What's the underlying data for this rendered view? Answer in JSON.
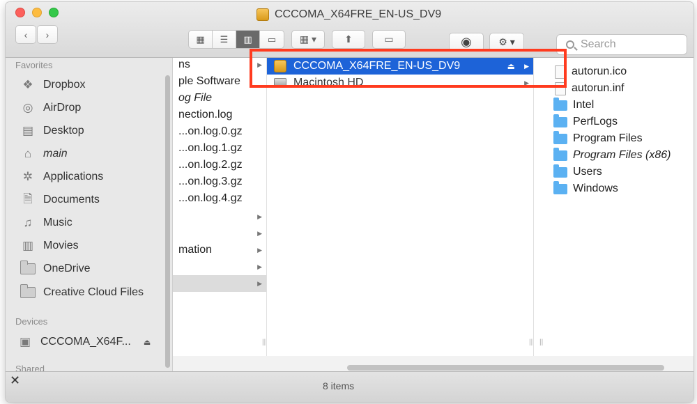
{
  "window": {
    "title": "CCCOMA_X64FRE_EN-US_DV9"
  },
  "toolbar": {
    "view_icons": [
      "grid-view",
      "list-view",
      "column-view",
      "cover-flow-view"
    ],
    "search_placeholder": "Search"
  },
  "sidebar": {
    "favorites_header": "Favorites",
    "favorites": [
      {
        "label": "Dropbox",
        "icon": "dropbox-icon"
      },
      {
        "label": "AirDrop",
        "icon": "airdrop-icon"
      },
      {
        "label": "Desktop",
        "icon": "desktop-icon"
      },
      {
        "label": "main",
        "icon": "home-icon"
      },
      {
        "label": "Applications",
        "icon": "applications-icon"
      },
      {
        "label": "Documents",
        "icon": "documents-icon"
      },
      {
        "label": "Music",
        "icon": "music-icon"
      },
      {
        "label": "Movies",
        "icon": "movies-icon"
      },
      {
        "label": "OneDrive",
        "icon": "folder-icon"
      },
      {
        "label": "Creative Cloud Files",
        "icon": "folder-icon"
      }
    ],
    "devices_header": "Devices",
    "devices": [
      {
        "label": "CCCOMA_X64F...",
        "icon": "disk-icon"
      }
    ],
    "shared_header": "Shared"
  },
  "column1": {
    "items": [
      {
        "label": "ns"
      },
      {
        "label": "ple Software"
      },
      {
        "label": "og File"
      },
      {
        "label": "nection.log"
      },
      {
        "label": "...on.log.0.gz"
      },
      {
        "label": "...on.log.1.gz"
      },
      {
        "label": "...on.log.2.gz"
      },
      {
        "label": "...on.log.3.gz"
      },
      {
        "label": "...on.log.4.gz"
      },
      {
        "label": "mation"
      }
    ]
  },
  "column2": {
    "items": [
      {
        "label": "CCCOMA_X64FRE_EN-US_DV9"
      },
      {
        "label": "Macintosh HD"
      }
    ]
  },
  "column3": {
    "items": [
      {
        "label": "autorun.ico",
        "kind": "file"
      },
      {
        "label": "autorun.inf",
        "kind": "file"
      },
      {
        "label": "Intel",
        "kind": "folder"
      },
      {
        "label": "PerfLogs",
        "kind": "folder"
      },
      {
        "label": "Program Files",
        "kind": "folder"
      },
      {
        "label": "Program Files (x86)",
        "kind": "folder"
      },
      {
        "label": "Users",
        "kind": "folder"
      },
      {
        "label": "Windows",
        "kind": "folder"
      }
    ]
  },
  "status": {
    "text": "8 items"
  },
  "colors": {
    "selection": "#1d63d8",
    "highlight_box": "#ff3b1f"
  }
}
